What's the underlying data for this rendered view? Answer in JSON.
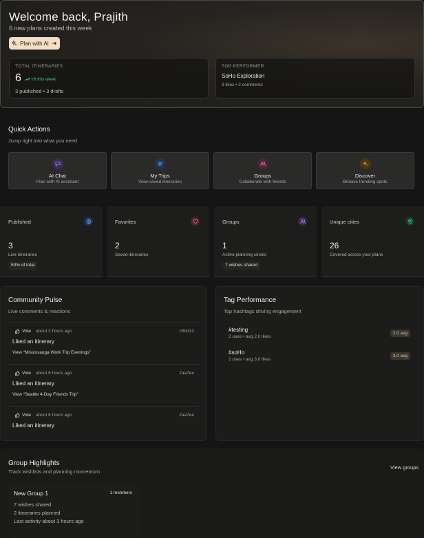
{
  "hero": {
    "title": "Welcome back, Prajith",
    "subtitle": "6 new plans created this week",
    "cta_label": "Plan with AI",
    "total": {
      "label": "TOTAL ITINERARIES",
      "value": "6",
      "trend": "+6 this week",
      "sub": "3 published • 3 drafts"
    },
    "top": {
      "label": "TOP PERFORMER",
      "name": "SoHo Exploration",
      "meta": "3 likes • 2 comments"
    }
  },
  "quick_actions": {
    "title": "Quick Actions",
    "subtitle": "Jump right into what you need",
    "items": [
      {
        "title": "AI Chat",
        "desc": "Plan with AI assistant",
        "icon": "chat-icon",
        "color": "#a78bfa"
      },
      {
        "title": "My Trips",
        "desc": "View saved itineraries",
        "icon": "list-icon",
        "color": "#60a5fa"
      },
      {
        "title": "Groups",
        "desc": "Collaborate with friends",
        "icon": "users-icon",
        "color": "#f472b6"
      },
      {
        "title": "Discover",
        "desc": "Browse trending spots",
        "icon": "sparkle-icon",
        "color": "#f59e0b"
      }
    ]
  },
  "metrics": [
    {
      "label": "Published",
      "value": "3",
      "desc": "Live itineraries",
      "chip": "50% of total",
      "icon": "globe-icon",
      "color": "#60a5fa"
    },
    {
      "label": "Favorites",
      "value": "2",
      "desc": "Saved itineraries",
      "chip": "",
      "icon": "heart-icon",
      "color": "#fb7185"
    },
    {
      "label": "Groups",
      "value": "1",
      "desc": "Active planning circles",
      "chip": "7 wishes shared",
      "icon": "users-icon",
      "color": "#c084fc"
    },
    {
      "label": "Unique cities",
      "value": "26",
      "desc": "Covered across your plans",
      "chip": "",
      "icon": "pin-icon",
      "color": "#34d399"
    }
  ],
  "pulse": {
    "title": "Community Pulse",
    "subtitle": "Live comments & reactions",
    "items": [
      {
        "vote": "Vote",
        "time": "about 2 hours ago",
        "id": "c5bd12",
        "action": "Liked an itinerary",
        "link": "View “Mississauga Work Trip Evenings”"
      },
      {
        "vote": "Vote",
        "time": "about 6 hours ago",
        "id": "2aa7ee",
        "action": "Liked an itinerary",
        "link": "View “Seattle 4-Day Friends Trip”"
      },
      {
        "vote": "Vote",
        "time": "about 6 hours ago",
        "id": "2aa7ee",
        "action": "Liked an itinerary",
        "link": ""
      }
    ]
  },
  "tags": {
    "title": "Tag Performance",
    "subtitle": "Top hashtags driving engagement",
    "items": [
      {
        "name": "#testing",
        "meta": "2 uses • avg 2.0 likes",
        "avg": "2.0 avg"
      },
      {
        "name": "#soHo",
        "meta": "1 uses • avg 3.0 likes",
        "avg": "3.0 avg"
      }
    ]
  },
  "groups": {
    "title": "Group Highlights",
    "subtitle": "Track wishlists and planning momentum",
    "view_label": "View groups",
    "card": {
      "name": "New Group 1",
      "members": "1 members",
      "wishes": "7 wishes shared",
      "planned": "2 itineraries planned",
      "activity": "Last activity about 3 hours ago"
    }
  }
}
